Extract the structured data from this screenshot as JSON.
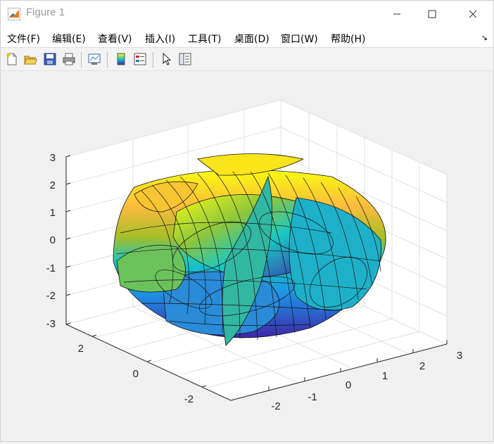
{
  "window": {
    "title": "Figure 1"
  },
  "menu": [
    {
      "label": "文件(F)"
    },
    {
      "label": "编辑(E)"
    },
    {
      "label": "查看(V)"
    },
    {
      "label": "插入(I)"
    },
    {
      "label": "工具(T)"
    },
    {
      "label": "桌面(D)"
    },
    {
      "label": "窗口(W)"
    },
    {
      "label": "帮助(H)"
    }
  ],
  "toolbar": {
    "icons": [
      "new-figure-icon",
      "open-file-icon",
      "save-icon",
      "print-icon",
      "link-plot-icon",
      "colorbar-icon",
      "legend-icon",
      "pointer-icon",
      "property-inspector-icon"
    ]
  },
  "axes": {
    "z_ticks": [
      "3",
      "2",
      "1",
      "0",
      "-1",
      "-2",
      "-3"
    ],
    "y_ticks": [
      "2",
      "0",
      "-2"
    ],
    "x_ticks": [
      "-2",
      "-1",
      "0",
      "1",
      "2",
      "3"
    ]
  },
  "colors": {
    "accent_yellow": "#f9fb0e",
    "accent_blue": "#3e26a8",
    "accent_teal": "#1ac7c2"
  }
}
